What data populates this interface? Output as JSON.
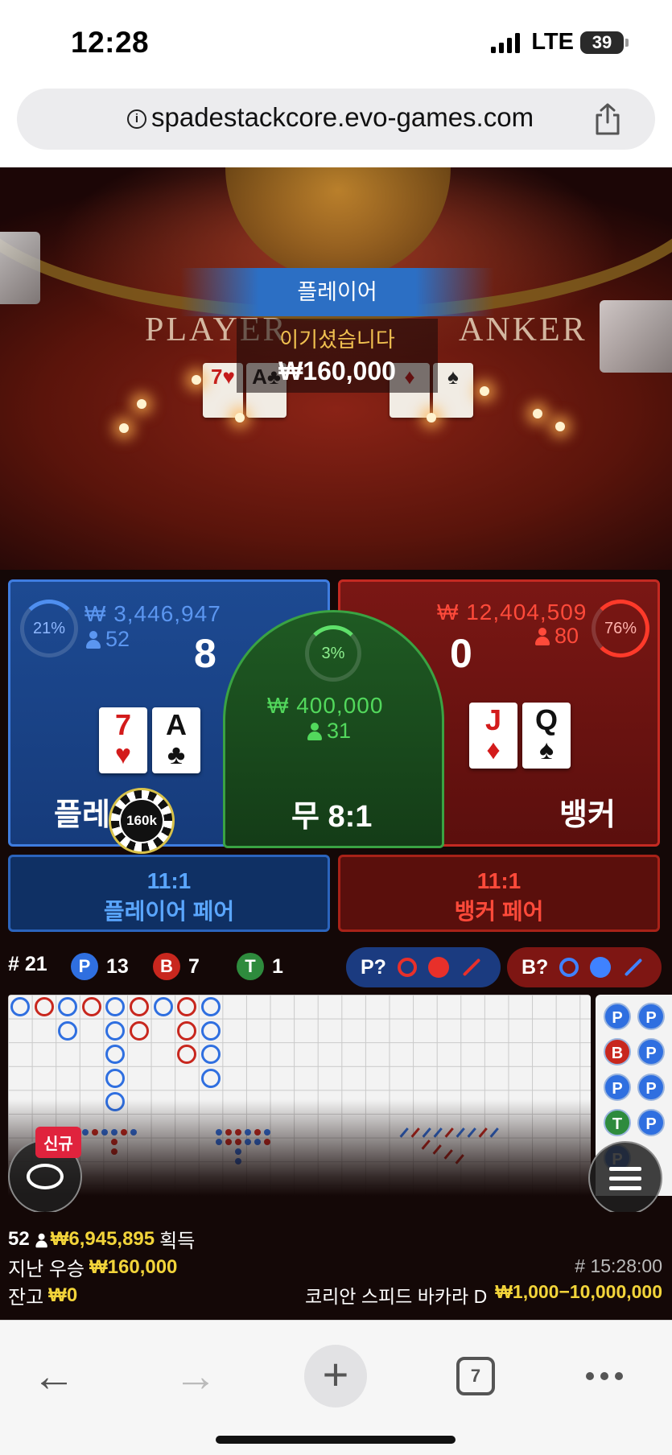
{
  "status_bar": {
    "time": "12:28",
    "network": "LTE",
    "battery": "39"
  },
  "browser": {
    "url": "spadestackcore.evo-games.com",
    "tab_count": "7"
  },
  "video": {
    "table_words": [
      "PLAYER",
      "ANKER"
    ],
    "result_banner": "플레이어",
    "result_label": "이기셨습니다",
    "result_amount": "₩160,000"
  },
  "bets": {
    "player": {
      "percent": "21%",
      "amount": "₩ 3,446,947",
      "players": "52",
      "score": "8",
      "cards": [
        {
          "rank": "7",
          "suit": "♥",
          "color": "red"
        },
        {
          "rank": "A",
          "suit": "♣",
          "color": "black"
        }
      ],
      "label": "플레이어",
      "chip": "160k"
    },
    "tie": {
      "percent": "3%",
      "amount": "₩ 400,000",
      "players": "31",
      "label": "무 8:1"
    },
    "banker": {
      "percent": "76%",
      "amount": "₩ 12,404,509",
      "players": "80",
      "score": "0",
      "cards": [
        {
          "rank": "J",
          "suit": "♦",
          "color": "red"
        },
        {
          "rank": "Q",
          "suit": "♠",
          "color": "black"
        }
      ],
      "label": "뱅커"
    },
    "player_pair": {
      "odds": "11:1",
      "label": "플레이어 페어"
    },
    "banker_pair": {
      "odds": "11:1",
      "label": "뱅커 페어"
    }
  },
  "stats": {
    "round": "# 21",
    "player_badge": "P",
    "player_count": "13",
    "banker_badge": "B",
    "banker_count": "7",
    "tie_badge": "T",
    "tie_count": "1",
    "ask_player": "P?",
    "ask_banker": "B?"
  },
  "road_side_badges": [
    "P",
    "B",
    "P",
    "T",
    "P"
  ],
  "new_badge": "신규",
  "footer": {
    "players": "52",
    "win_amount": "₩6,945,895",
    "win_label": "획득",
    "last_win_label": "지난 우승",
    "last_win_amount": "₩160,000",
    "balance_label": "잔고",
    "balance_amount": "₩0",
    "game_id": "# 15:28:00",
    "table_name": "코리안 스피드 바카라 D",
    "limits": "₩1,000−10,000,000"
  },
  "colors": {
    "player": "#2f6fe0",
    "banker": "#c8271e",
    "tie": "#2e8b3d",
    "gold": "#f2d43a"
  }
}
